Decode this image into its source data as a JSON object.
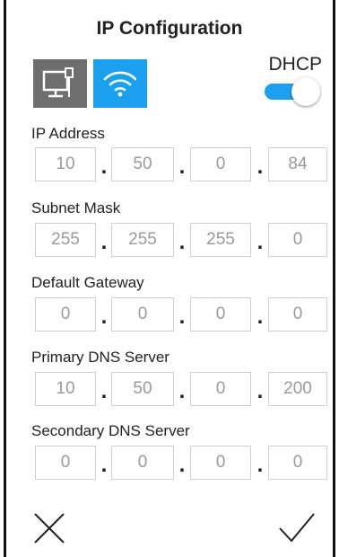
{
  "header": {
    "title": "IP Configuration"
  },
  "network_type": {
    "ethernet_icon": "ethernet-icon",
    "wifi_icon": "wifi-icon",
    "selected": "wifi"
  },
  "dhcp": {
    "label": "DHCP",
    "enabled": true
  },
  "fields": {
    "ip_address": {
      "label": "IP Address",
      "octets": [
        "10",
        "50",
        "0",
        "84"
      ]
    },
    "subnet_mask": {
      "label": "Subnet Mask",
      "octets": [
        "255",
        "255",
        "255",
        "0"
      ]
    },
    "default_gateway": {
      "label": "Default Gateway",
      "octets": [
        "0",
        "0",
        "0",
        "0"
      ]
    },
    "primary_dns": {
      "label": "Primary DNS Server",
      "octets": [
        "10",
        "50",
        "0",
        "200"
      ]
    },
    "secondary_dns": {
      "label": "Secondary DNS Server",
      "octets": [
        "0",
        "0",
        "0",
        "0"
      ]
    },
    "separator": "."
  },
  "actions": {
    "cancel_icon": "close-icon",
    "confirm_icon": "check-icon"
  },
  "colors": {
    "accent": "#1aa0ef",
    "inactive_button": "#6e6e6e",
    "field_text": "#9a9a9a"
  }
}
